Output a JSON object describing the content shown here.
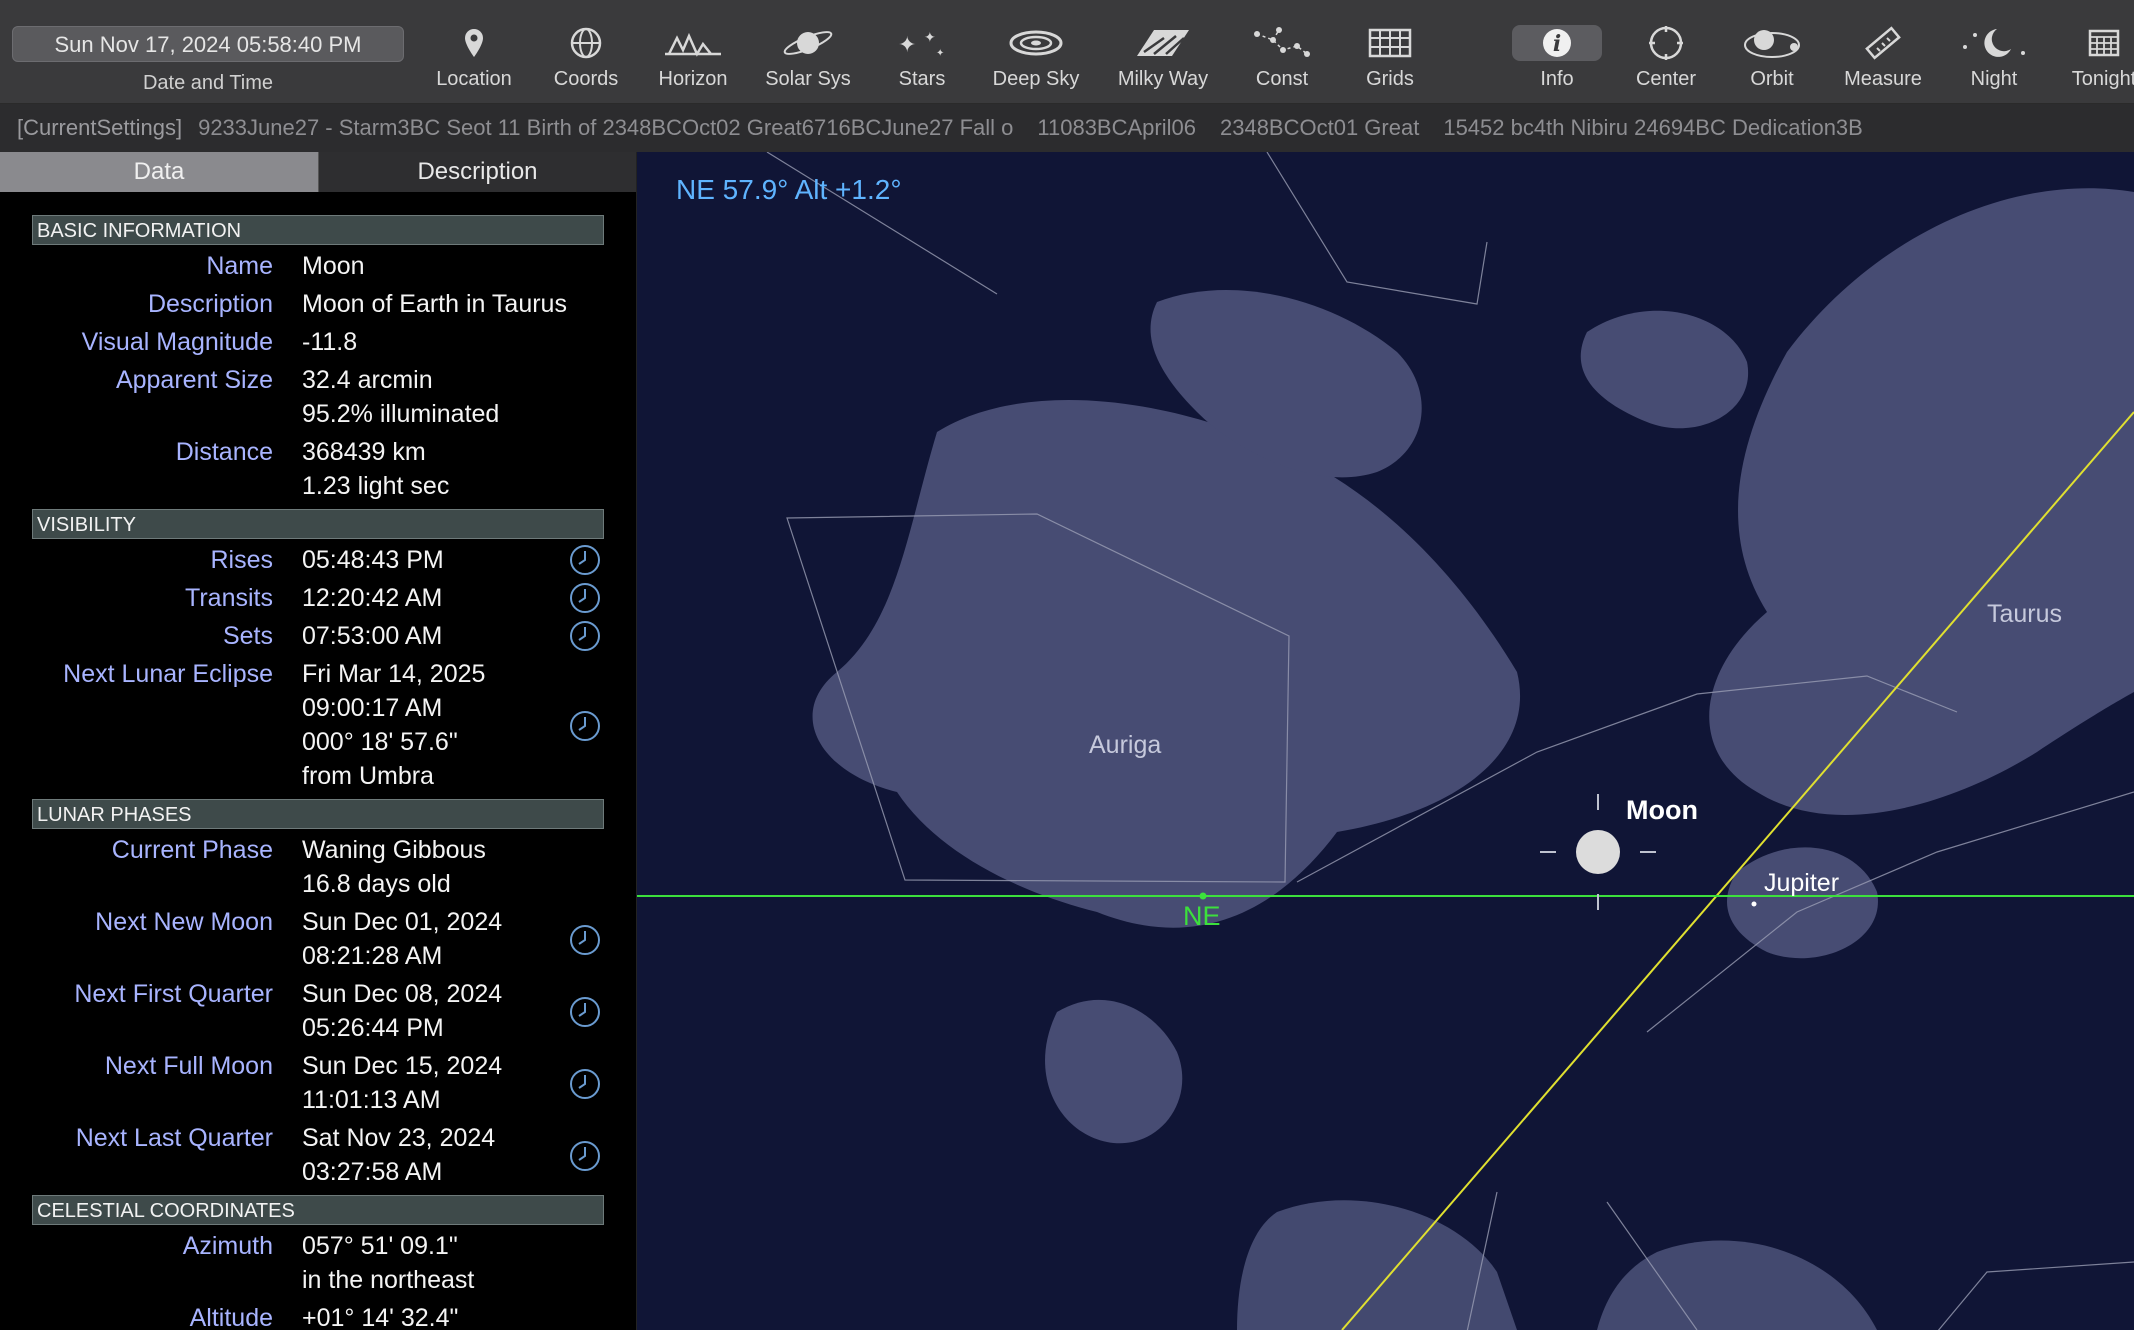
{
  "toolbar": {
    "datetime": "Sun Nov 17, 2024  05:58:40 PM",
    "datetime_label": "Date and Time",
    "tools": [
      {
        "label": "Location",
        "icon": "location-pin-icon"
      },
      {
        "label": "Coords",
        "icon": "coords-icon"
      },
      {
        "label": "Horizon",
        "icon": "horizon-icon"
      },
      {
        "label": "Solar Sys",
        "icon": "planet-icon"
      },
      {
        "label": "Stars",
        "icon": "stars-icon"
      },
      {
        "label": "Deep Sky",
        "icon": "galaxy-icon"
      },
      {
        "label": "Milky Way",
        "icon": "milky-way-icon"
      },
      {
        "label": "Const",
        "icon": "constellation-icon"
      },
      {
        "label": "Grids",
        "icon": "grid-icon"
      },
      {
        "label": "Info",
        "icon": "info-icon",
        "active": true
      },
      {
        "label": "Center",
        "icon": "center-icon"
      },
      {
        "label": "Orbit",
        "icon": "orbit-icon"
      },
      {
        "label": "Measure",
        "icon": "ruler-icon"
      },
      {
        "label": "Night",
        "icon": "moon-stars-icon"
      },
      {
        "label": "Tonight",
        "icon": "calendar-icon"
      }
    ]
  },
  "ticker": {
    "current": "[CurrentSettings]",
    "items": [
      "9233June27 - Starm3BC Seot 11 Birth of 2348BCOct02 Great6716BCJune27 Fall o",
      "11083BCApril06",
      "2348BCOct01 Great",
      "15452 bc4th Nibiru 24694BC Dedication3B"
    ]
  },
  "panel": {
    "tabs": {
      "data": "Data",
      "description": "Description"
    },
    "sections": {
      "basic": "BASIC INFORMATION",
      "visibility": "VISIBILITY",
      "phases": "LUNAR PHASES",
      "coords": "CELESTIAL COORDINATES"
    },
    "basic": {
      "name_label": "Name",
      "name": "Moon",
      "desc_label": "Description",
      "desc": "Moon of Earth in Taurus",
      "mag_label": "Visual Magnitude",
      "mag": "-11.8",
      "size_label": "Apparent Size",
      "size_1": "32.4 arcmin",
      "size_2": "95.2% illuminated",
      "dist_label": "Distance",
      "dist_1": "368439 km",
      "dist_2": "1.23 light sec"
    },
    "visibility": {
      "rises_label": "Rises",
      "rises": "05:48:43 PM",
      "transits_label": "Transits",
      "transits": "12:20:42 AM",
      "sets_label": "Sets",
      "sets": "07:53:00 AM",
      "eclipse_label": "Next Lunar Eclipse",
      "eclipse_1": "Fri Mar 14, 2025",
      "eclipse_2": "09:00:17 AM",
      "eclipse_3": "000° 18' 57.6\"",
      "eclipse_4": "from Umbra"
    },
    "phases": {
      "current_label": "Current Phase",
      "current_1": "Waning Gibbous",
      "current_2": "16.8 days old",
      "new_label": "Next New Moon",
      "new_1": "Sun Dec 01, 2024",
      "new_2": "08:21:28 AM",
      "first_label": "Next First Quarter",
      "first_1": "Sun Dec 08, 2024",
      "first_2": "05:26:44 PM",
      "full_label": "Next Full Moon",
      "full_1": "Sun Dec 15, 2024",
      "full_2": "11:01:13 AM",
      "last_label": "Next Last Quarter",
      "last_1": "Sat Nov 23, 2024",
      "last_2": "03:27:58 AM"
    },
    "coords": {
      "az_label": "Azimuth",
      "az_1": "057° 51' 09.1\"",
      "az_2": "in the northeast",
      "alt_label": "Altitude",
      "alt_1": "+01° 14' 32.4\""
    }
  },
  "sky": {
    "heading": "NE 57.9° Alt +1.2°",
    "constellations": {
      "auriga": "Auriga",
      "taurus": "Taurus"
    },
    "moon_label": "Moon",
    "jupiter_label": "Jupiter",
    "horizon_label": "NE",
    "colors": {
      "background": "#101536",
      "horizon": "#3ce03c",
      "ecliptic": "#e0e030",
      "heading": "#5fb4ff"
    }
  }
}
